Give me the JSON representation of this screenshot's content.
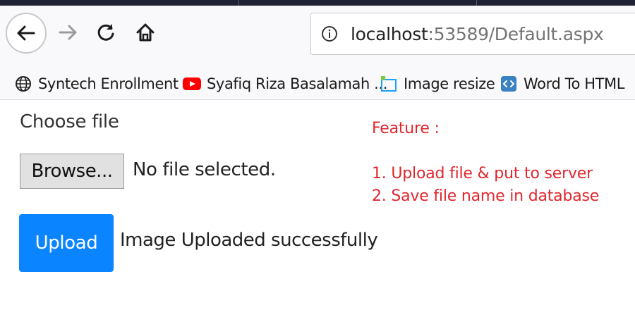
{
  "browser": {
    "url_host": "localhost",
    "url_rest": ":53589/Default.aspx",
    "bookmarks": [
      {
        "label": "Syntech Enrollment",
        "icon": "globe-icon"
      },
      {
        "label": "Syafiq Riza Basalamah ...",
        "icon": "youtube-icon"
      },
      {
        "label": "Image resize",
        "icon": "image-resize-icon"
      },
      {
        "label": "Word To HTML",
        "icon": "code-icon"
      }
    ]
  },
  "page": {
    "choose_label": "Choose file",
    "browse_label": "Browse...",
    "file_status": "No file selected.",
    "upload_label": "Upload",
    "upload_status": "Image Uploaded successfully"
  },
  "feature": {
    "title": "Feature :",
    "items": [
      "1. Upload file & put to server",
      "2. Save file name in database"
    ]
  },
  "colors": {
    "upload_button": "#0a84ff",
    "feature_text": "#e0262d"
  }
}
